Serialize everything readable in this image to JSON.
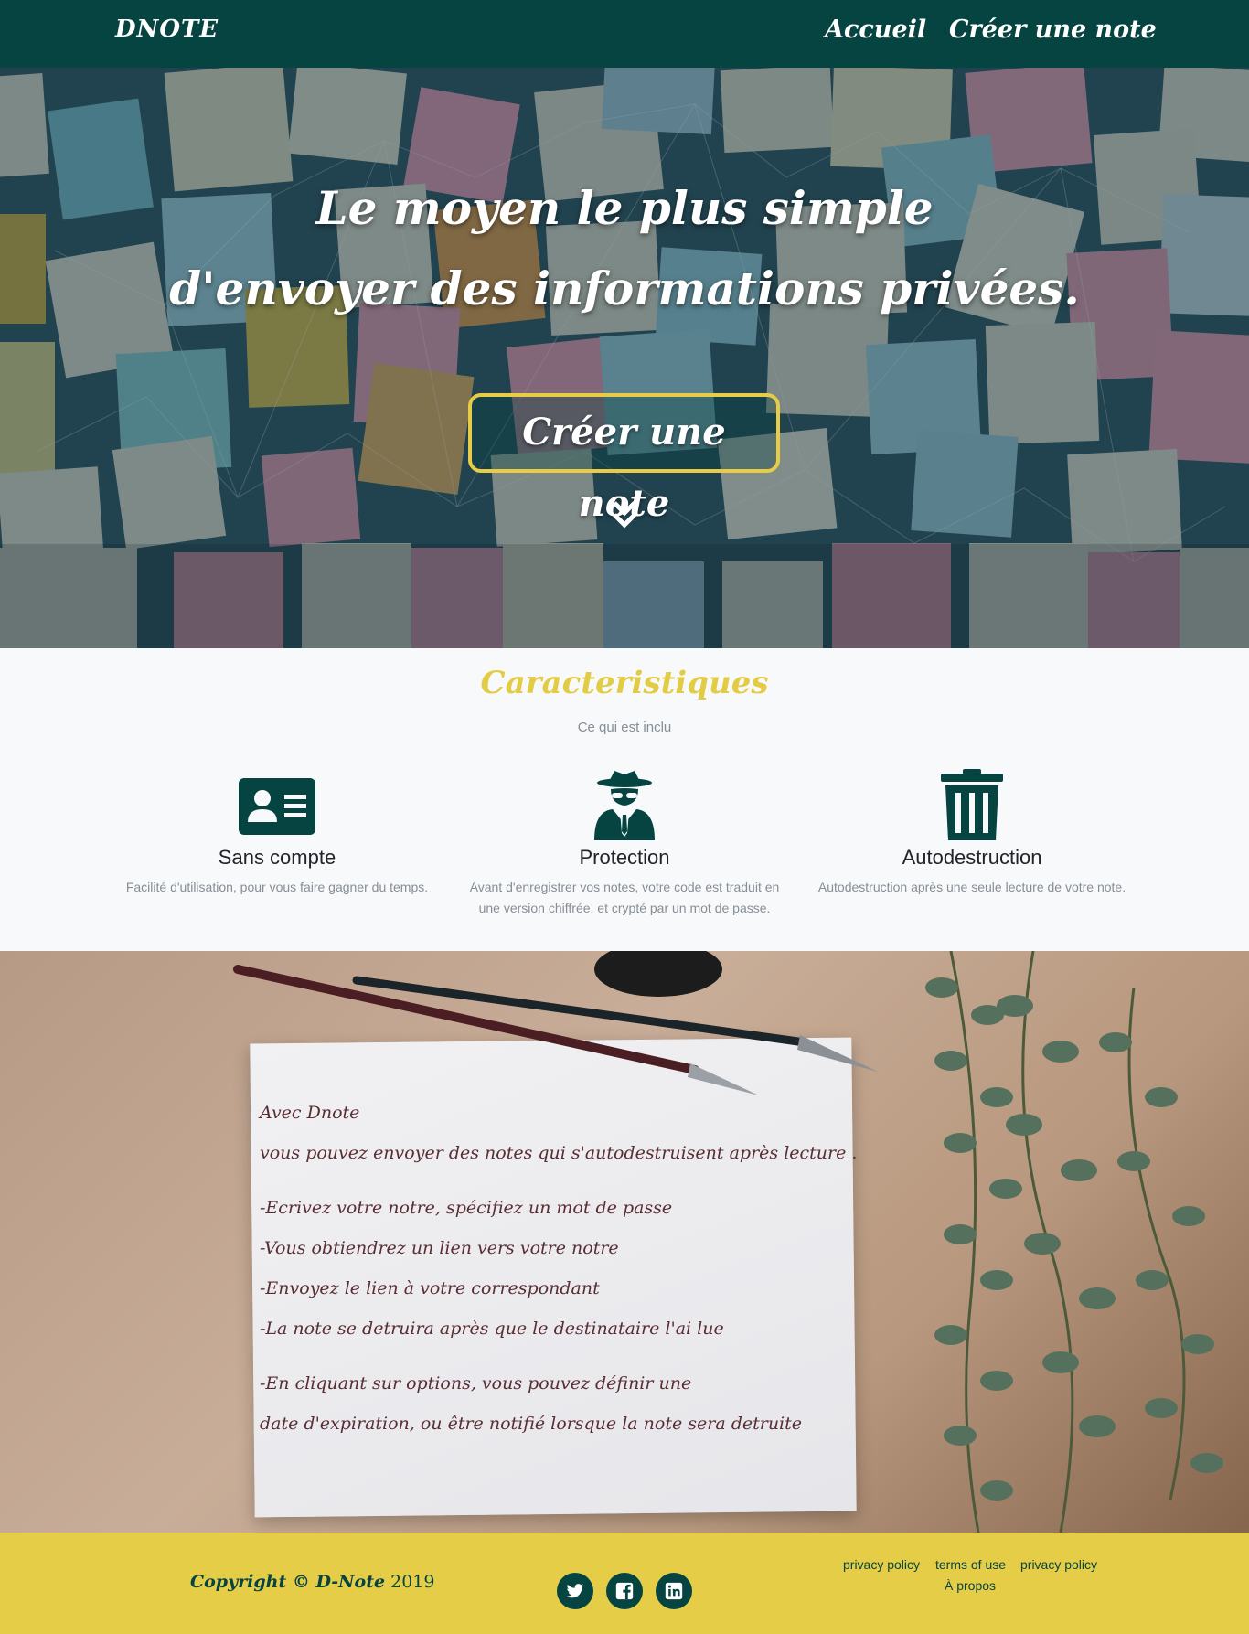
{
  "navbar": {
    "brand": "DNOTE",
    "links": [
      {
        "label": "Accueil"
      },
      {
        "label": "Créer une note"
      }
    ]
  },
  "hero": {
    "title_line1": "Le moyen le plus simple",
    "title_line2": "d'envoyer des informations privées.",
    "cta_label": "Créer une note",
    "scroll_icon": "double-chevron-down-icon"
  },
  "features": {
    "title": "Caracteristiques",
    "subtitle": "Ce qui est inclu",
    "items": [
      {
        "icon": "id-card-icon",
        "name": "Sans compte",
        "description": "Facilité d'utilisation, pour vous faire gagner du temps."
      },
      {
        "icon": "spy-icon",
        "name": "Protection",
        "description": "Avant d'enregistrer vos notes, votre code est traduit en une version chiffrée, et crypté par un mot de passe."
      },
      {
        "icon": "trash-icon",
        "name": "Autodestruction",
        "description": "Autodestruction après une seule lecture de votre note."
      }
    ]
  },
  "letter": {
    "lines": [
      "Avec Dnote",
      "vous pouvez envoyer des notes qui s'autodestruisent après lecture .",
      "-Ecrivez votre notre, spécifiez un mot de passe",
      "-Vous obtiendrez un lien vers votre notre",
      "-Envoyez le lien à votre correspondant",
      "-La note se detruira après que le destinataire l'ai lue",
      "-En cliquant sur options, vous pouvez définir une",
      "date d'expiration, ou être notifié lorsque la note sera detruite"
    ]
  },
  "footer": {
    "copyright_prefix": "Copyright © D-Note",
    "copyright_year": "2019",
    "social": [
      {
        "icon": "twitter-icon"
      },
      {
        "icon": "facebook-icon"
      },
      {
        "icon": "linkedin-icon"
      }
    ],
    "links": [
      "privacy policy",
      "terms of use",
      "privacy policy",
      "À propos"
    ],
    "colors": {
      "bar": "#e5cd48",
      "primary": "#064441"
    }
  }
}
